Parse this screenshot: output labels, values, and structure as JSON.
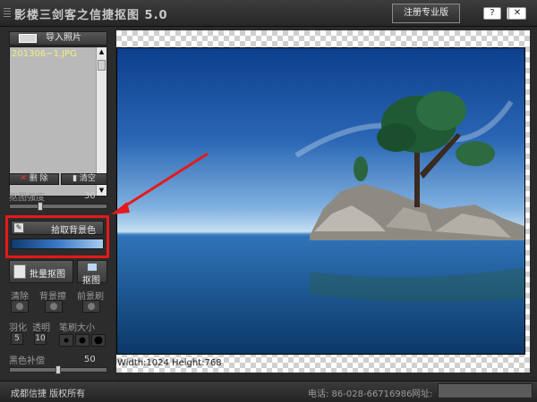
{
  "window": {
    "title": "影楼三剑客之信捷抠图 5.0",
    "register_label": "注册专业版",
    "help_icon_glyph": "?",
    "minimize_icon_glyph": "—",
    "close_icon_glyph": "✕"
  },
  "sidebar": {
    "import_label": "导入照片",
    "files": [
      "201306~1.JPG"
    ],
    "delete_label": "删 除",
    "clear_label": "清空",
    "strength_label": "抠图强度",
    "strength_value": "30",
    "strength_level": 0.3,
    "pick_bg_label": "拾取背景色",
    "batch_label": "批量抠图",
    "cut_label": "抠图",
    "tools": {
      "clear_label": "清除",
      "background_brush_label": "背景擦",
      "foreground_brush_label": "前景刷"
    },
    "feather_label": "羽化",
    "feather_value": "5",
    "transparency_label": "透明",
    "transparency_value": "10",
    "brush_size_label": "笔刷大小",
    "black_comp_label": "黑色补偿",
    "black_comp_value": "50",
    "black_comp_level": 0.5
  },
  "canvas": {
    "info": "Width:1024  Height:768",
    "highlight_color": "#e51a1a"
  },
  "statusbar": {
    "company": "成都信捷  版权所有",
    "phone": "电话: 86-028-66716986",
    "site_label": "网址:"
  }
}
